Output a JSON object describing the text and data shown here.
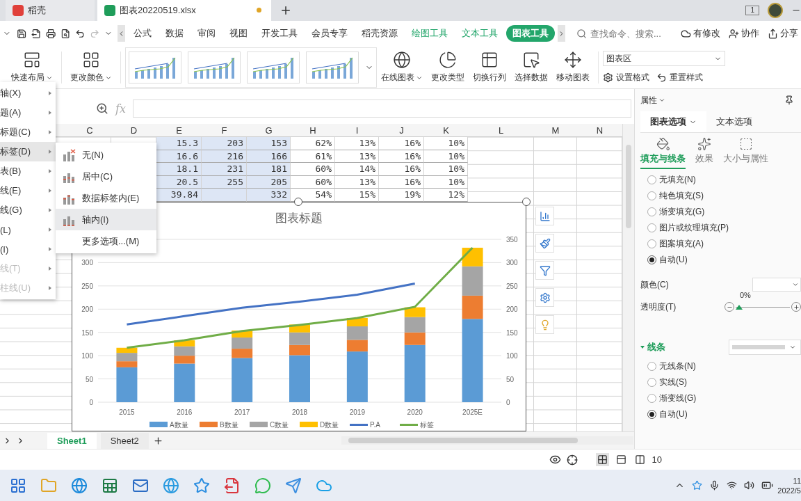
{
  "file_tabs": [
    {
      "label": "稻壳",
      "kind": "home",
      "selected": false,
      "unsaved": false
    },
    {
      "label": "图表20220519.xlsx",
      "kind": "sheet",
      "selected": true,
      "unsaved": true
    }
  ],
  "window_count": "1",
  "menu": [
    {
      "label": "公式",
      "kind": "plain",
      "selected": false
    },
    {
      "label": "数据",
      "kind": "plain",
      "selected": false
    },
    {
      "label": "审阅",
      "kind": "plain",
      "selected": false
    },
    {
      "label": "视图",
      "kind": "plain",
      "selected": false
    },
    {
      "label": "开发工具",
      "kind": "plain",
      "selected": false
    },
    {
      "label": "会员专享",
      "kind": "plain",
      "selected": false
    },
    {
      "label": "稻壳资源",
      "kind": "plain",
      "selected": false
    },
    {
      "label": "绘图工具",
      "kind": "tool",
      "selected": false
    },
    {
      "label": "文本工具",
      "kind": "tool",
      "selected": false
    },
    {
      "label": "图表工具",
      "kind": "tool",
      "selected": true
    }
  ],
  "search": {
    "placeholder": "查找命令、搜索..."
  },
  "actions": [
    {
      "label": "有修改",
      "kind": "cloud"
    },
    {
      "label": "协作",
      "kind": "user"
    },
    {
      "label": "分享",
      "kind": "share"
    }
  ],
  "ribbon": {
    "left": [
      {
        "label": "快速布局",
        "kind": "layout",
        "caret": true
      },
      {
        "label": "更改颜色",
        "kind": "colors",
        "caret": true
      }
    ],
    "tools": [
      {
        "label": "在线图表",
        "kind": "online",
        "caret": true
      },
      {
        "label": "更改类型",
        "kind": "type",
        "caret": false
      },
      {
        "label": "切换行列",
        "kind": "switch",
        "caret": false
      },
      {
        "label": "选择数据",
        "kind": "select",
        "caret": false
      },
      {
        "label": "移动图表",
        "kind": "move",
        "caret": false
      }
    ],
    "element_select": "图表区",
    "format_buttons": [
      {
        "label": "设置格式",
        "kind": "format"
      },
      {
        "label": "重置样式",
        "kind": "reset"
      }
    ]
  },
  "formula_bar": {
    "fx": "fx"
  },
  "sheet": {
    "columns": [
      "C",
      "D",
      "E",
      "F",
      "G",
      "H",
      "I",
      "J",
      "K",
      "L",
      "M",
      "N"
    ],
    "rows": [
      {
        "cells": [
          {
            "text": ""
          },
          {
            "text": ""
          },
          {
            "text": "15.3",
            "highlighted": true
          },
          {
            "text": "203",
            "highlighted": true
          },
          {
            "text": "153",
            "highlighted": true
          },
          {
            "text": "62%",
            "highlighted": false
          },
          {
            "text": "13%",
            "highlighted": false
          },
          {
            "text": "16%",
            "highlighted": false
          },
          {
            "text": "10%",
            "highlighted": false
          }
        ]
      },
      {
        "cells": [
          {
            "text": ""
          },
          {
            "text": ""
          },
          {
            "text": "16.6",
            "highlighted": true
          },
          {
            "text": "216",
            "highlighted": true
          },
          {
            "text": "166",
            "highlighted": true
          },
          {
            "text": "61%",
            "highlighted": false
          },
          {
            "text": "13%",
            "highlighted": false
          },
          {
            "text": "16%",
            "highlighted": false
          },
          {
            "text": "10%",
            "highlighted": false
          }
        ]
      },
      {
        "cells": [
          {
            "text": ""
          },
          {
            "text": ""
          },
          {
            "text": "18.1",
            "highlighted": true
          },
          {
            "text": "231",
            "highlighted": true
          },
          {
            "text": "181",
            "highlighted": true
          },
          {
            "text": "60%",
            "highlighted": false
          },
          {
            "text": "14%",
            "highlighted": false
          },
          {
            "text": "16%",
            "highlighted": false
          },
          {
            "text": "10%",
            "highlighted": false
          }
        ]
      },
      {
        "cells": [
          {
            "text": ""
          },
          {
            "text": ""
          },
          {
            "text": "20.5",
            "highlighted": true
          },
          {
            "text": "255",
            "highlighted": true
          },
          {
            "text": "205",
            "highlighted": true
          },
          {
            "text": "60%",
            "highlighted": false
          },
          {
            "text": "13%",
            "highlighted": false
          },
          {
            "text": "16%",
            "highlighted": false
          },
          {
            "text": "10%",
            "highlighted": false
          }
        ]
      },
      {
        "cells": [
          {
            "text": ""
          },
          {
            "text": ""
          },
          {
            "text": "39.84",
            "highlighted": true
          },
          {
            "text": "",
            "highlighted": true
          },
          {
            "text": "332",
            "highlighted": true
          },
          {
            "text": "54%",
            "highlighted": false
          },
          {
            "text": "15%",
            "highlighted": false
          },
          {
            "text": "19%",
            "highlighted": false
          },
          {
            "text": "12%",
            "highlighted": false
          }
        ]
      }
    ]
  },
  "chart": {
    "title": "图表标题",
    "left_axis_labels": [
      "300",
      "250",
      "200",
      "150",
      "100",
      "50",
      "0"
    ],
    "right_axis_labels": [
      "350",
      "300",
      "250",
      "200",
      "150",
      "100",
      "50",
      "0"
    ],
    "chart_data": {
      "type": "bar",
      "stacked": true,
      "grid": true,
      "legend": "bottom",
      "categories": [
        "2015",
        "2016",
        "2017",
        "2018",
        "2019",
        "2020",
        "2025E"
      ],
      "ylim": [
        0,
        350
      ],
      "yticks": [
        0,
        50,
        100,
        150,
        200,
        250,
        300,
        350
      ],
      "series": [
        {
          "name": "A数量",
          "type": "bar",
          "color": "#5b9bd5",
          "values": [
            75,
            83,
            95,
            101,
            109,
            123,
            179
          ]
        },
        {
          "name": "B数量",
          "type": "bar",
          "color": "#ed7d31",
          "values": [
            13,
            17,
            20,
            22,
            25,
            27,
            50
          ]
        },
        {
          "name": "C数量",
          "type": "bar",
          "color": "#a5a5a5",
          "values": [
            18,
            20,
            24,
            27,
            29,
            33,
            63
          ]
        },
        {
          "name": "D数量",
          "type": "bar",
          "color": "#ffc000",
          "values": [
            11,
            13,
            15,
            17,
            18,
            21,
            40
          ]
        },
        {
          "name": "P.A",
          "type": "line",
          "color": "#4472c4",
          "values": [
            167,
            185,
            203,
            216,
            231,
            255,
            null
          ]
        },
        {
          "name": "标签",
          "type": "line",
          "color": "#70ad47",
          "values": [
            117,
            133,
            153,
            166,
            181,
            205,
            332
          ]
        }
      ]
    }
  },
  "chart_menu": [
    {
      "label": "轴(X)",
      "selected": false,
      "disabled": false
    },
    {
      "label": "题(A)",
      "selected": false,
      "disabled": false
    },
    {
      "label": "标题(C)",
      "selected": false,
      "disabled": false
    },
    {
      "label": "标签(D)",
      "selected": true,
      "disabled": false
    },
    {
      "label": "表(B)",
      "selected": false,
      "disabled": false
    },
    {
      "label": "线(E)",
      "selected": false,
      "disabled": false
    },
    {
      "label": "线(G)",
      "selected": false,
      "disabled": false
    },
    {
      "label": "(L)",
      "selected": false,
      "disabled": false
    },
    {
      "label": "(I)",
      "selected": false,
      "disabled": false
    },
    {
      "label": "线(T)",
      "selected": false,
      "disabled": true
    },
    {
      "label": "柱线(U)",
      "selected": false,
      "disabled": true
    }
  ],
  "label_submenu": [
    {
      "label": "无(N)",
      "kind": "none",
      "selected": false
    },
    {
      "label": "居中(C)",
      "kind": "center",
      "selected": false
    },
    {
      "label": "数据标签内(E)",
      "kind": "inside_end",
      "selected": false
    },
    {
      "label": "轴内(I)",
      "kind": "inside_base",
      "selected": true
    },
    {
      "label": "更多选项...(M)",
      "kind": "more",
      "selected": false
    }
  ],
  "panel": {
    "title": "属性",
    "tabs": [
      {
        "label": "图表选项",
        "selected": true
      },
      {
        "label": "文本选项",
        "selected": false
      }
    ],
    "subtabs": [
      {
        "label": "填充与线条",
        "kind": "fill",
        "selected": true
      },
      {
        "label": "效果",
        "kind": "effect",
        "selected": false
      },
      {
        "label": "大小与属性",
        "kind": "size",
        "selected": false
      }
    ],
    "fill_options": [
      {
        "label": "无填充(N)",
        "selected": false
      },
      {
        "label": "纯色填充(S)",
        "selected": false
      },
      {
        "label": "渐变填充(G)",
        "selected": false
      },
      {
        "label": "图片或纹理填充(P)",
        "selected": false
      },
      {
        "label": "图案填充(A)",
        "selected": false
      },
      {
        "label": "自动(U)",
        "selected": true
      }
    ],
    "color_label": "颜色(C)",
    "transparency": {
      "label": "透明度(T)",
      "reading": "0%",
      "level": 0
    },
    "line_section": {
      "label": "线条",
      "expanded": true
    },
    "line_options": [
      {
        "label": "无线条(N)",
        "selected": false
      },
      {
        "label": "实线(S)",
        "selected": false
      },
      {
        "label": "渐变线(G)",
        "selected": false
      },
      {
        "label": "自动(U)",
        "selected": true
      }
    ]
  },
  "sheet_tabs": [
    {
      "label": "Sheet1",
      "selected": true
    },
    {
      "label": "Sheet2",
      "selected": false
    }
  ],
  "status": {
    "zoom": "10"
  },
  "clock": {
    "time": "11",
    "date": "2022/5"
  }
}
